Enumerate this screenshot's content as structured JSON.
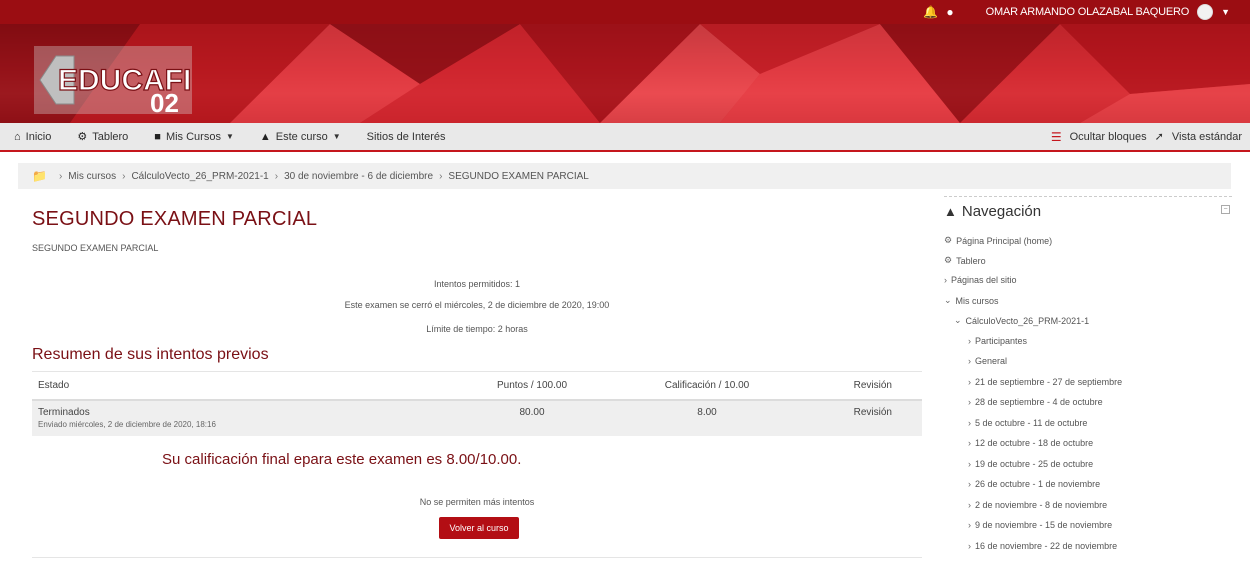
{
  "topbar": {
    "bell_icon": "bell-icon",
    "chat_icon": "chat-bubble-icon",
    "user_name": "OMAR ARMANDO OLAZABAL BAQUERO"
  },
  "banner": {
    "logo_text_main": "EDUCAFI",
    "logo_text_num": "02"
  },
  "nav": {
    "inicio": "Inicio",
    "tablero": "Tablero",
    "mis_cursos": "Mis Cursos",
    "este_curso": "Este curso",
    "sitios": "Sitios de Interés",
    "ocultar": "Ocultar bloques",
    "vista": "Vista estándar"
  },
  "breadcrumb": [
    "Mis cursos",
    "CálculoVecto_26_PRM-2021-1",
    "30 de noviembre - 6 de diciembre",
    "SEGUNDO EXAMEN PARCIAL"
  ],
  "main": {
    "title": "SEGUNDO EXAMEN PARCIAL",
    "subtitle": "SEGUNDO EXAMEN PARCIAL",
    "intentos": "Intentos permitidos: 1",
    "cerro": "Este examen se cerró el miércoles, 2 de diciembre de 2020, 19:00",
    "limite": "Límite de tiempo: 2 horas",
    "resumen": "Resumen de sus intentos previos",
    "table": {
      "headers": [
        "Estado",
        "Puntos / 100.00",
        "Calificación / 10.00",
        "Revisión"
      ],
      "row": {
        "estado": "Terminados",
        "enviado": "Enviado miércoles, 2 de diciembre de 2020, 18:16",
        "puntos": "80.00",
        "calificacion": "8.00",
        "revision": "Revisión"
      }
    },
    "final": "Su calificación final epara este examen es 8.00/10.00.",
    "no_mas": "No se permiten más intentos",
    "volver": "Volver al curso"
  },
  "navigation": {
    "title": "Navegación",
    "home": "Página Principal (home)",
    "tablero": "Tablero",
    "paginas": "Páginas del sitio",
    "mis_cursos": "Mis cursos",
    "curso": "CálculoVecto_26_PRM-2021-1",
    "items": [
      "Participantes",
      "General",
      "21 de septiembre - 27 de septiembre",
      "28 de septiembre - 4 de octubre",
      "5 de octubre - 11 de octubre",
      "12 de octubre - 18 de octubre",
      "19 de octubre - 25 de octubre",
      "26 de octubre - 1 de noviembre",
      "2 de noviembre - 8 de noviembre",
      "9 de noviembre - 15 de noviembre",
      "16 de noviembre - 22 de noviembre"
    ]
  }
}
